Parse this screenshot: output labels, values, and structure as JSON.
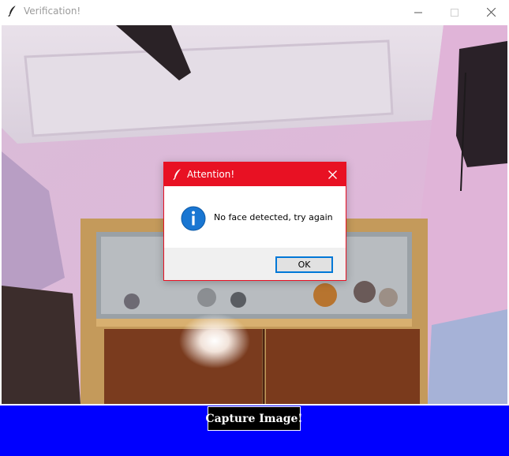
{
  "window": {
    "title": "Verification!",
    "app_icon": "feather-icon",
    "controls": [
      "minimize-icon",
      "maximize-icon",
      "close-icon"
    ]
  },
  "camera": {
    "content": "webcam-feed"
  },
  "capture_button": {
    "label": "Capture Image!"
  },
  "dialog": {
    "title": "Attention!",
    "icon": "info-icon",
    "message": "No face detected, try again",
    "ok_label": "OK",
    "accent_color": "#e81123"
  },
  "colors": {
    "bottom_bar": "#0000ff",
    "capture_button_bg": "#000000",
    "ok_button_border": "#0078d7"
  }
}
